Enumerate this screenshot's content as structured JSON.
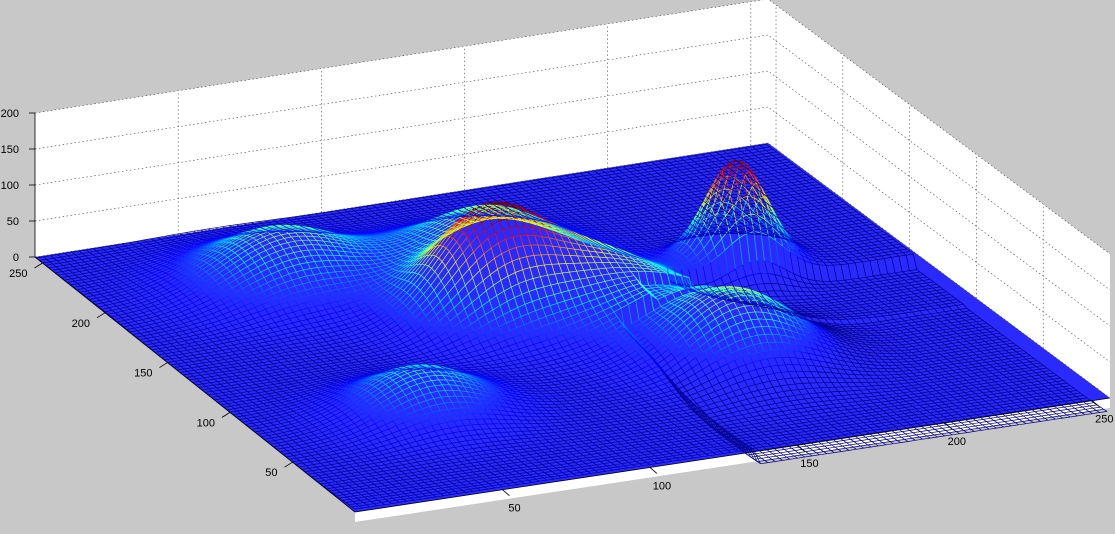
{
  "chart_data": {
    "type": "surface",
    "plot_style": "mesh",
    "colormap": "jet",
    "background_color": "#c8c8c8",
    "pane_color": "#ffffff",
    "grid": true,
    "title": "",
    "xlabel": "",
    "ylabel": "",
    "zlabel": "",
    "xlim": [
      0,
      256
    ],
    "ylim": [
      0,
      256
    ],
    "zlim": [
      0,
      200
    ],
    "x_ticks": [
      50,
      100,
      150,
      200,
      250
    ],
    "y_ticks": [
      50,
      100,
      150,
      200,
      250
    ],
    "z_ticks": [
      0,
      50,
      100,
      150,
      200
    ],
    "x_tick_labels": [
      "50",
      "100",
      "150",
      "200",
      "250"
    ],
    "y_tick_labels": [
      "50",
      "100",
      "150",
      "200",
      "250"
    ],
    "z_tick_labels": [
      "0",
      "50",
      "100",
      "150",
      "200"
    ],
    "peaks": [
      {
        "x": 55,
        "y": 75,
        "height": 60,
        "spread": 18
      },
      {
        "x": 62,
        "y": 200,
        "height": 75,
        "spread": 22
      },
      {
        "x": 108,
        "y": 147,
        "height": 125,
        "spread": 17
      },
      {
        "x": 128,
        "y": 190,
        "height": 75,
        "spread": 20
      },
      {
        "x": 142,
        "y": 138,
        "height": 75,
        "spread": 22
      },
      {
        "x": 168,
        "y": 88,
        "height": 100,
        "spread": 20
      },
      {
        "x": 200,
        "y": 158,
        "height": 145,
        "spread": 10
      }
    ],
    "cliffs": [
      {
        "x_from": 136,
        "x_to": 256,
        "y_at": 106,
        "depth": 22
      },
      {
        "x_from": 170,
        "x_to": 256,
        "y_at": 143,
        "depth": 18
      },
      {
        "x_from": 150,
        "x_to": 256,
        "y_at": 121,
        "depth": 15
      }
    ]
  }
}
